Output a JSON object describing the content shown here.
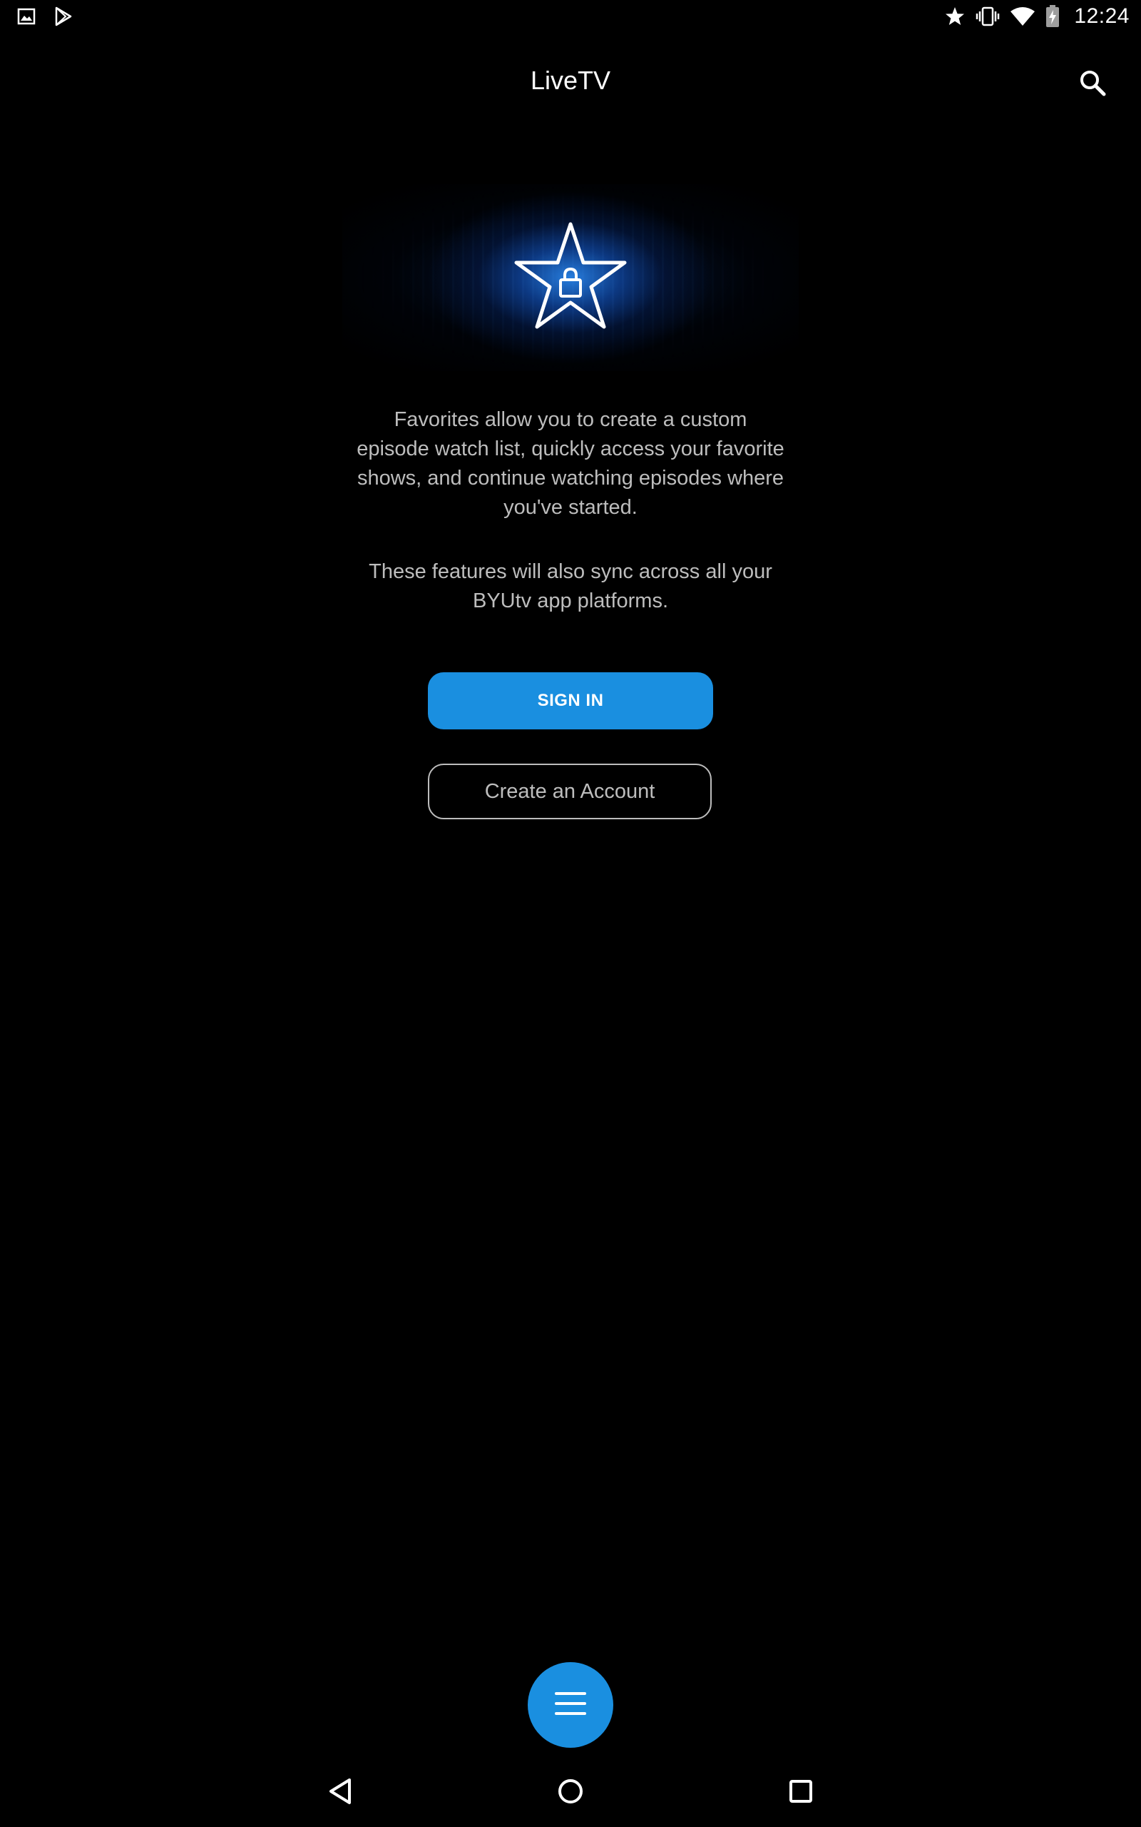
{
  "status_bar": {
    "time": "12:24",
    "left_icons": [
      "image-icon",
      "play-store-icon"
    ],
    "right_icons": [
      "star-icon",
      "vibrate-icon",
      "wifi-icon",
      "battery-charging-icon"
    ]
  },
  "app_bar": {
    "title": "LiveTV",
    "search_icon": "search-icon"
  },
  "hero": {
    "icon": "star-lock-icon",
    "accent_color": "#1a8fe0"
  },
  "content": {
    "paragraph_1": "Favorites allow you to create a custom episode watch list, quickly access your favorite shows, and continue watching episodes where you've started.",
    "paragraph_2": "These features will also sync across all your BYUtv app platforms.",
    "sign_in_label": "SIGN IN",
    "create_account_label": "Create an Account"
  },
  "fab": {
    "icon": "menu-icon",
    "color": "#1a8fe0"
  },
  "nav_bar": {
    "icons": [
      "back-icon",
      "home-icon",
      "recents-icon"
    ]
  }
}
